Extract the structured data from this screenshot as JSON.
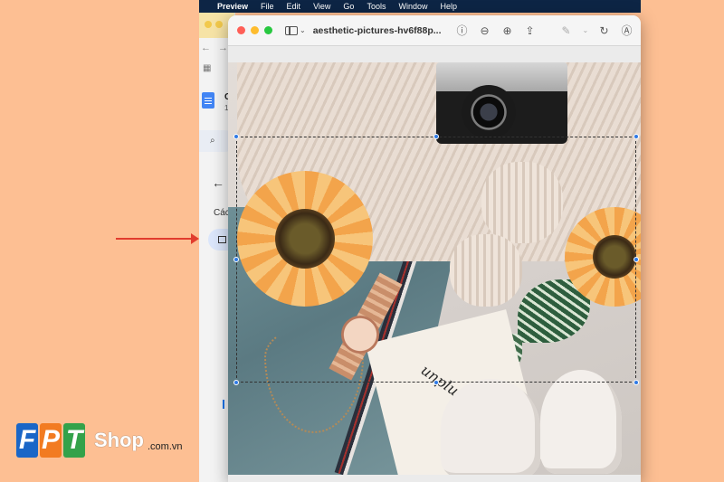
{
  "menubar": {
    "apple_icon": "apple-icon",
    "app_name": "Preview",
    "items": [
      "File",
      "Edit",
      "View",
      "Go",
      "Tools",
      "Window",
      "Help"
    ]
  },
  "browser": {
    "doc_title": "C",
    "doc_subtitle": "1",
    "section_label": "Các"
  },
  "preview": {
    "document_name": "aesthetic-pictures-hv6f88p...",
    "toolbar_icons": [
      "info-icon",
      "zoom-out-icon",
      "zoom-in-icon",
      "share-icon",
      "markup-icon",
      "rotate-icon",
      "annotate-icon",
      "search-icon"
    ],
    "image_text": "unplug"
  },
  "logo": {
    "letters": [
      "F",
      "P",
      "T"
    ],
    "shop": "Shop",
    "domain": ".com.vn"
  },
  "colors": {
    "background": "#fdbf93",
    "menubar": "#0d2545",
    "selection_handle": "#2f7ae5",
    "arrow": "#e13c2e"
  }
}
